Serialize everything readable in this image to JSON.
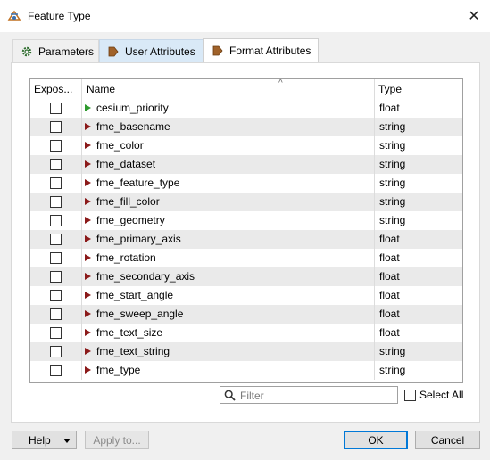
{
  "window": {
    "title": "Feature Type",
    "close_glyph": "✕",
    "icon": "feature-type-icon"
  },
  "tabs": [
    {
      "label": "Parameters",
      "icon": "gear-icon",
      "active": false
    },
    {
      "label": "User Attributes",
      "icon": "attribute-tag-icon",
      "active": false
    },
    {
      "label": "Format Attributes",
      "icon": "attribute-tag-icon",
      "active": true
    }
  ],
  "table": {
    "headers": {
      "expose": "Expos...",
      "name": "Name",
      "type": "Type"
    },
    "sort_glyph": "^",
    "rows": [
      {
        "name": "cesium_priority",
        "type": "float",
        "exposed": false,
        "arrow": "green"
      },
      {
        "name": "fme_basename",
        "type": "string",
        "exposed": false,
        "arrow": "red"
      },
      {
        "name": "fme_color",
        "type": "string",
        "exposed": false,
        "arrow": "red"
      },
      {
        "name": "fme_dataset",
        "type": "string",
        "exposed": false,
        "arrow": "red"
      },
      {
        "name": "fme_feature_type",
        "type": "string",
        "exposed": false,
        "arrow": "red"
      },
      {
        "name": "fme_fill_color",
        "type": "string",
        "exposed": false,
        "arrow": "red"
      },
      {
        "name": "fme_geometry",
        "type": "string",
        "exposed": false,
        "arrow": "red"
      },
      {
        "name": "fme_primary_axis",
        "type": "float",
        "exposed": false,
        "arrow": "red"
      },
      {
        "name": "fme_rotation",
        "type": "float",
        "exposed": false,
        "arrow": "red"
      },
      {
        "name": "fme_secondary_axis",
        "type": "float",
        "exposed": false,
        "arrow": "red"
      },
      {
        "name": "fme_start_angle",
        "type": "float",
        "exposed": false,
        "arrow": "red"
      },
      {
        "name": "fme_sweep_angle",
        "type": "float",
        "exposed": false,
        "arrow": "red"
      },
      {
        "name": "fme_text_size",
        "type": "float",
        "exposed": false,
        "arrow": "red"
      },
      {
        "name": "fme_text_string",
        "type": "string",
        "exposed": false,
        "arrow": "red"
      },
      {
        "name": "fme_type",
        "type": "string",
        "exposed": false,
        "arrow": "red"
      }
    ]
  },
  "filter": {
    "placeholder": "Filter",
    "value": ""
  },
  "select_all": {
    "label": "Select All",
    "checked": false
  },
  "buttons": {
    "help": "Help",
    "apply": "Apply to...",
    "ok": "OK",
    "cancel": "Cancel"
  },
  "colors": {
    "accent": "#0078d7",
    "arrow_red": "#8b1a1a",
    "arrow_green": "#2e9a2e",
    "row_alt": "#eaeaea"
  }
}
